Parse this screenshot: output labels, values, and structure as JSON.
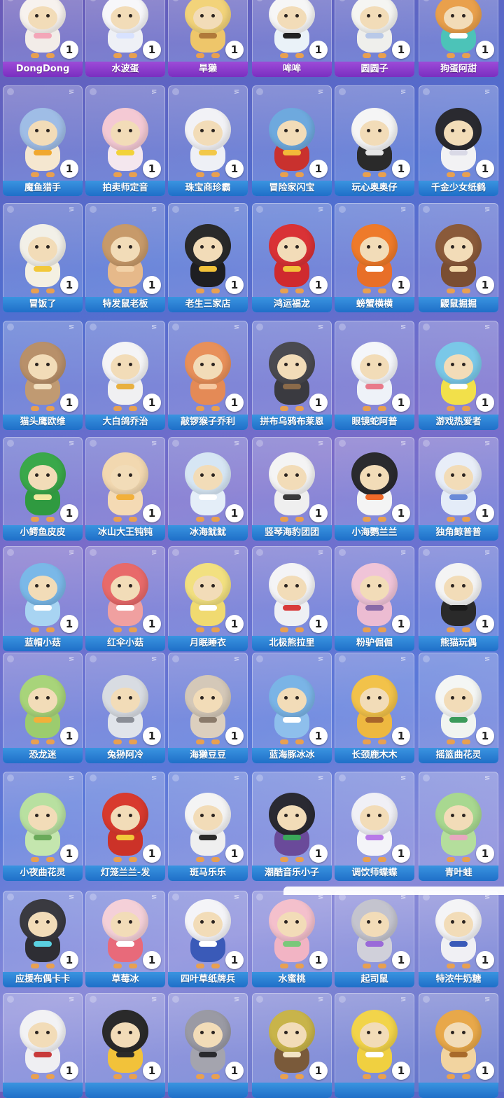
{
  "rows": [
    {
      "style": "purple",
      "items": [
        {
          "name": "DongDong",
          "count": "1",
          "icon": "pink-cloud-costume-icon",
          "head": "#f7f2ee",
          "body": "#f2ece8",
          "accent": "#f3a6b8"
        },
        {
          "name": "水波蛋",
          "count": "1",
          "icon": "white-egg-blob-icon",
          "head": "#f7f7fa",
          "body": "#eef0f6",
          "accent": "#d8e2ff"
        },
        {
          "name": "旱獭",
          "count": "1",
          "icon": "yellow-marmot-icon",
          "head": "#f2d37a",
          "body": "#eec66a",
          "accent": "#b07a3a"
        },
        {
          "name": "哞哞",
          "count": "1",
          "icon": "cow-costume-icon",
          "head": "#f6f6f6",
          "body": "#eaf2f8",
          "accent": "#222222"
        },
        {
          "name": "圆圆子",
          "count": "1",
          "icon": "white-seal-icon",
          "head": "#f5f5f2",
          "body": "#efefec",
          "accent": "#b9c9e8"
        },
        {
          "name": "狗蛋阿甜",
          "count": "1",
          "icon": "shiba-dog-icon",
          "head": "#e9a04c",
          "body": "#4cc3b8",
          "accent": "#ffffff"
        }
      ]
    },
    {
      "style": "blue",
      "items": [
        {
          "name": "魔鱼猎手",
          "count": "1",
          "icon": "fish-hunter-icon",
          "head": "#9fbde6",
          "body": "#f5e7d0",
          "accent": "#f0a830"
        },
        {
          "name": "拍卖师定音",
          "count": "1",
          "icon": "auctioneer-icon",
          "head": "#f4c9d4",
          "body": "#f4e7ee",
          "accent": "#f2d23a"
        },
        {
          "name": "珠宝商珍霸",
          "count": "1",
          "icon": "jeweler-icon",
          "head": "#f2f2f6",
          "body": "#eef0f6",
          "accent": "#f2c84a"
        },
        {
          "name": "冒险家闪宝",
          "count": "1",
          "icon": "adventurer-icon",
          "head": "#6ea9de",
          "body": "#c9312e",
          "accent": "#f2b93a"
        },
        {
          "name": "玩心奥奥仔",
          "count": "1",
          "icon": "playful-kid-icon",
          "head": "#f5f5f5",
          "body": "#2a2a2a",
          "accent": "#e6e6e6"
        },
        {
          "name": "千金少女纸鹤",
          "count": "1",
          "icon": "paper-crane-girl-icon",
          "head": "#2a2a30",
          "body": "#f2f2f4",
          "accent": "#d9d9e6"
        }
      ]
    },
    {
      "style": "blue",
      "items": [
        {
          "name": "冒饭了",
          "count": "1",
          "icon": "rice-cooker-icon",
          "head": "#f2f0e8",
          "body": "#f4f0e2",
          "accent": "#f2c83a"
        },
        {
          "name": "特发鼠老板",
          "count": "1",
          "icon": "mouse-boss-icon",
          "head": "#c79a6a",
          "body": "#e6b98a",
          "accent": "#f2d2a8"
        },
        {
          "name": "老生三家店",
          "count": "1",
          "icon": "shopkeeper-icon",
          "head": "#2a2a2a",
          "body": "#1e1e22",
          "accent": "#f2c23a"
        },
        {
          "name": "鸿运福龙",
          "count": "1",
          "icon": "lucky-dragon-icon",
          "head": "#d93236",
          "body": "#cf2a2e",
          "accent": "#f2c23a"
        },
        {
          "name": "螃蟹横横",
          "count": "1",
          "icon": "crab-icon",
          "head": "#ee7a2a",
          "body": "#e86f28",
          "accent": "#ffffff"
        },
        {
          "name": "鼹鼠掘掘",
          "count": "1",
          "icon": "mole-icon",
          "head": "#8a5a3a",
          "body": "#7a4e32",
          "accent": "#f2d8a8"
        }
      ]
    },
    {
      "style": "blue",
      "items": [
        {
          "name": "猫头鹰欧维",
          "count": "1",
          "icon": "owl-icon",
          "head": "#b8906a",
          "body": "#c09a72",
          "accent": "#f2e0c0"
        },
        {
          "name": "大白鸽乔治",
          "count": "1",
          "icon": "white-dove-icon",
          "head": "#f4f4f6",
          "body": "#f0f0f2",
          "accent": "#e8b040"
        },
        {
          "name": "敲锣猴子乔利",
          "count": "1",
          "icon": "monkey-icon",
          "head": "#e8905a",
          "body": "#e48a56",
          "accent": "#f6c8a0"
        },
        {
          "name": "拼布乌鸦布莱恩",
          "count": "1",
          "icon": "patchwork-crow-icon",
          "head": "#4a4a50",
          "body": "#3a3a40",
          "accent": "#8a6a4a"
        },
        {
          "name": "眼镜蛇阿普",
          "count": "1",
          "icon": "cobra-icon",
          "head": "#f4f6fa",
          "body": "#eef2f8",
          "accent": "#e87a8a"
        },
        {
          "name": "游戏热爱者",
          "count": "1",
          "icon": "gamer-icon",
          "head": "#7ac8e8",
          "body": "#f2e04a",
          "accent": "#ffffff"
        }
      ]
    },
    {
      "style": "blue",
      "items": [
        {
          "name": "小鳄鱼皮皮",
          "count": "1",
          "icon": "crocodile-icon",
          "head": "#3aa84a",
          "body": "#2f9a40",
          "accent": "#f2e8a0"
        },
        {
          "name": "冰山大王钝钝",
          "count": "1",
          "icon": "iceberg-king-icon",
          "head": "#f2d8b0",
          "body": "#f4dab4",
          "accent": "#f2b03a"
        },
        {
          "name": "冰海鱿鱿",
          "count": "1",
          "icon": "squid-icon",
          "head": "#d6e6f4",
          "body": "#e4eef8",
          "accent": "#ffffff"
        },
        {
          "name": "竖琴海豹团团",
          "count": "1",
          "icon": "harp-seal-icon",
          "head": "#f4f4f4",
          "body": "#efefef",
          "accent": "#3a3a3a"
        },
        {
          "name": "小海鹦兰兰",
          "count": "1",
          "icon": "puffin-icon",
          "head": "#2a2a2e",
          "body": "#f4f4f4",
          "accent": "#f06a2a"
        },
        {
          "name": "独角鲸普普",
          "count": "1",
          "icon": "narwhal-icon",
          "head": "#e8eef8",
          "body": "#e4ecf8",
          "accent": "#6a8ad8"
        }
      ]
    },
    {
      "style": "blue",
      "items": [
        {
          "name": "蓝帽小菇",
          "count": "1",
          "icon": "blue-mushroom-icon",
          "head": "#7ab8e8",
          "body": "#a8d4f2",
          "accent": "#ffffff"
        },
        {
          "name": "红伞小菇",
          "count": "1",
          "icon": "red-mushroom-icon",
          "head": "#e86a6a",
          "body": "#f0a0a0",
          "accent": "#ffffff"
        },
        {
          "name": "月眠睡衣",
          "count": "1",
          "icon": "moon-pajamas-icon",
          "head": "#f2e080",
          "body": "#f0da70",
          "accent": "#ffffff"
        },
        {
          "name": "北极熊拉里",
          "count": "1",
          "icon": "polar-bear-icon",
          "head": "#f4f4f6",
          "body": "#eef0f4",
          "accent": "#d83a3a"
        },
        {
          "name": "粉驴倔倔",
          "count": "1",
          "icon": "pink-donkey-icon",
          "head": "#f0c4d8",
          "body": "#ecbcd2",
          "accent": "#8a6aa8"
        },
        {
          "name": "熊猫玩偶",
          "count": "1",
          "icon": "panda-doll-icon",
          "head": "#f4f4f4",
          "body": "#2a2a2a",
          "accent": "#1a1a1a"
        }
      ]
    },
    {
      "style": "blue",
      "items": [
        {
          "name": "恐龙迷",
          "count": "1",
          "icon": "dinosaur-icon",
          "head": "#a8d47a",
          "body": "#9ccc6e",
          "accent": "#f2b03a"
        },
        {
          "name": "兔狲阿冷",
          "count": "1",
          "icon": "pallas-cat-icon",
          "head": "#d8dce2",
          "body": "#e0e4ea",
          "accent": "#8a8e96"
        },
        {
          "name": "海獭豆豆",
          "count": "1",
          "icon": "sea-otter-icon",
          "head": "#d4c8b8",
          "body": "#dccfbe",
          "accent": "#8a7a6a"
        },
        {
          "name": "蓝海豚冰冰",
          "count": "1",
          "icon": "blue-dolphin-icon",
          "head": "#7ab4e6",
          "body": "#8ebfec",
          "accent": "#ffffff"
        },
        {
          "name": "长颈鹿木木",
          "count": "1",
          "icon": "giraffe-icon",
          "head": "#f2c24a",
          "body": "#eeb840",
          "accent": "#a8642a"
        },
        {
          "name": "摇篮曲花灵",
          "count": "1",
          "icon": "lullaby-flower-icon",
          "head": "#f4f6f4",
          "body": "#f0f4f0",
          "accent": "#3a9a5a"
        }
      ]
    },
    {
      "style": "blue",
      "items": [
        {
          "name": "小夜曲花灵",
          "count": "1",
          "icon": "serenade-flower-icon",
          "head": "#b8e0a0",
          "body": "#c4e6ae",
          "accent": "#6aaa5a"
        },
        {
          "name": "灯笼兰兰-发",
          "count": "1",
          "icon": "lantern-icon",
          "head": "#d83a2e",
          "body": "#cc3228",
          "accent": "#f2c83a"
        },
        {
          "name": "斑马乐乐",
          "count": "1",
          "icon": "zebra-icon",
          "head": "#f4f4f4",
          "body": "#efefef",
          "accent": "#2a2a2a"
        },
        {
          "name": "潮酷音乐小子",
          "count": "1",
          "icon": "cool-music-kid-icon",
          "head": "#2a2a32",
          "body": "#6a4a9a",
          "accent": "#3aa85a"
        },
        {
          "name": "调饮师蝶蝶",
          "count": "1",
          "icon": "bartender-butterfly-icon",
          "head": "#f0f0f6",
          "body": "#f4f4f8",
          "accent": "#b87ae8"
        },
        {
          "name": "青叶蛙",
          "count": "1",
          "icon": "green-frog-icon",
          "head": "#a8d890",
          "body": "#b4de9c",
          "accent": "#e8a8c0"
        }
      ]
    },
    {
      "style": "blue",
      "items": [
        {
          "name": "应援布偶卡卡",
          "count": "1",
          "icon": "cheer-doll-icon",
          "head": "#3a3a40",
          "body": "#2e2e34",
          "accent": "#5ad0e0"
        },
        {
          "name": "草莓冰",
          "count": "1",
          "icon": "strawberry-ice-icon",
          "head": "#f4d0d8",
          "body": "#e86a7a",
          "accent": "#ffffff"
        },
        {
          "name": "四叶草纸牌兵",
          "count": "1",
          "icon": "clover-card-soldier-icon",
          "head": "#f4f4f8",
          "body": "#3a5ab8",
          "accent": "#ffffff"
        },
        {
          "name": "水蜜桃",
          "count": "1",
          "icon": "peach-icon",
          "head": "#f4c0cc",
          "body": "#f2b4c4",
          "accent": "#7ac87a"
        },
        {
          "name": "起司鼠",
          "count": "1",
          "icon": "cheese-mouse-icon",
          "head": "#c4c4ce",
          "body": "#d0d0da",
          "accent": "#9a6ad8"
        },
        {
          "name": "特浓牛奶糖",
          "count": "1",
          "icon": "milk-candy-icon",
          "head": "#f4f4f6",
          "body": "#f0f0f4",
          "accent": "#3a5ab8"
        }
      ]
    },
    {
      "style": "blue",
      "items": [
        {
          "name": "",
          "count": "1",
          "icon": "white-bulldog-icon",
          "head": "#f2f2f4",
          "body": "#efeff2",
          "accent": "#c83a3a"
        },
        {
          "name": "",
          "count": "1",
          "icon": "street-style-kid-icon",
          "head": "#2a2a2a",
          "body": "#f2c23a",
          "accent": "#2a2a2a"
        },
        {
          "name": "",
          "count": "1",
          "icon": "gray-donkey-icon",
          "head": "#9a9aa4",
          "body": "#a4a4ae",
          "accent": "#2a2a2e"
        },
        {
          "name": "",
          "count": "1",
          "icon": "adventure-hat-icon",
          "head": "#c8b44a",
          "body": "#7a5a3a",
          "accent": "#f2e4c4"
        },
        {
          "name": "",
          "count": "1",
          "icon": "lemon-hat-icon",
          "head": "#f2d44a",
          "body": "#f0d040",
          "accent": "#ffffff"
        },
        {
          "name": "",
          "count": "1",
          "icon": "orange-bear-icon",
          "head": "#e8a84a",
          "body": "#f2d4a0",
          "accent": "#a86a2a"
        }
      ]
    }
  ]
}
